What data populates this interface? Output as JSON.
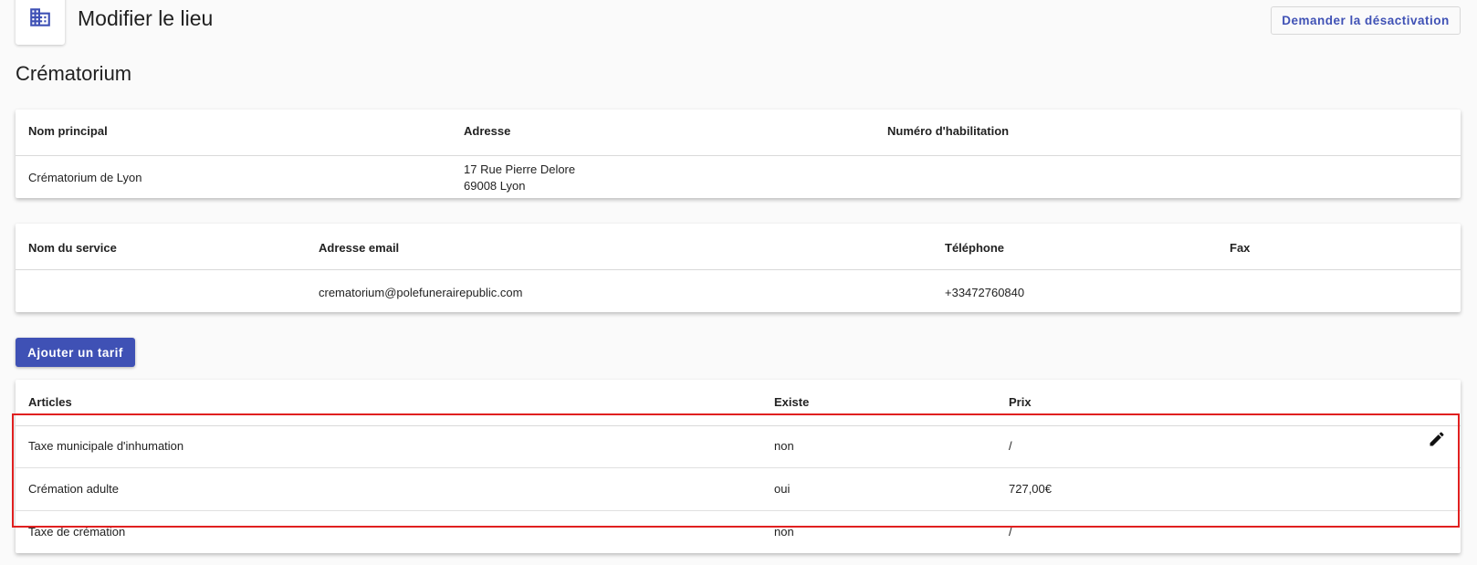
{
  "header": {
    "icon": "building-icon",
    "title": "Modifier le lieu",
    "deactivate_label": "Demander la désactivation"
  },
  "section_title": "Crématorium",
  "place_table": {
    "headers": [
      "Nom principal",
      "Adresse",
      "Numéro d'habilitation"
    ],
    "row": {
      "name": "Crématorium de Lyon",
      "address_line1": "17 Rue Pierre Delore",
      "address_line2": "69008 Lyon",
      "habilitation": ""
    }
  },
  "service_table": {
    "headers": [
      "Nom du service",
      "Adresse email",
      "Téléphone",
      "Fax"
    ],
    "row": {
      "service": "",
      "email": "crematorium@polefunerairepublic.com",
      "phone": "+33472760840",
      "fax": ""
    }
  },
  "add_tariff_label": "Ajouter un tarif",
  "tariffs_table": {
    "headers": [
      "Articles",
      "Existe",
      "Prix"
    ],
    "rows": [
      {
        "article": "Taxe municipale d'inhumation",
        "exists": "non",
        "price": "/"
      },
      {
        "article": "Crémation adulte",
        "exists": "oui",
        "price": "727,00€"
      },
      {
        "article": "Taxe de crémation",
        "exists": "non",
        "price": "/"
      }
    ],
    "edit_icon": "pencil-icon"
  },
  "colors": {
    "primary": "#3f51b5",
    "highlight": "#e02020",
    "background": "#fafafa"
  }
}
